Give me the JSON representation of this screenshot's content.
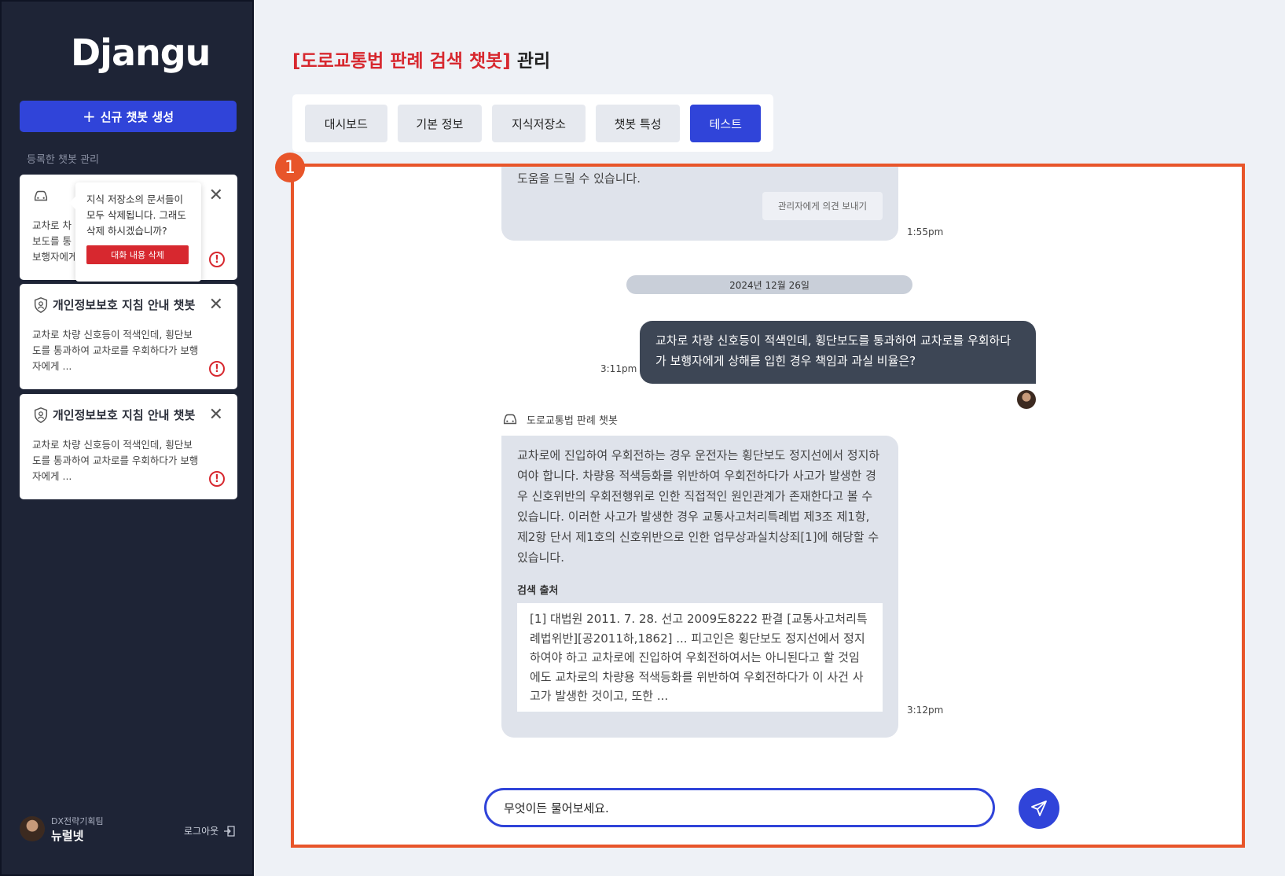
{
  "sidebar": {
    "logo": "Djangu",
    "new_button": {
      "icon": "plus-icon",
      "label": "신규 챗봇 생성"
    },
    "section_label": "등록한 챗봇 관리",
    "cards": [
      {
        "icon": "car-icon",
        "title": "",
        "body": "교차로 차\n보도를 통\n보행자에게"
      },
      {
        "icon": "shield-person-icon",
        "title": "개인정보보호 지침 안내 챗봇",
        "body": "교차로 차량 신호등이 적색인데, 횡단보도를 통과하여 교차로를 우회하다가 보행자에게 ..."
      },
      {
        "icon": "shield-person-icon",
        "title": "개인정보보호 지침 안내 챗봇",
        "body": "교차로 차량 신호등이 적색인데, 횡단보도를 통과하여 교차로를 우회하다가 보행자에게 ..."
      }
    ],
    "popover": {
      "text": "지식 저장소의 문서들이 모두 삭제됩니다. 그래도 삭제 하시겠습니까?",
      "button": "대화 내용 삭제"
    },
    "user": {
      "team": "DX전략기획팀",
      "name": "뉴럴넷"
    },
    "logout": "로그아웃"
  },
  "header": {
    "title_highlight": "[도로교통법 판례 검색 챗봇]",
    "title_rest": " 관리"
  },
  "tabs": [
    "대시보드",
    "기본 정보",
    "지식저장소",
    "챗봇 특성",
    "테스트"
  ],
  "active_tab": "테스트",
  "step_marker": "1",
  "chat": {
    "prev_bot_tail": "도움을 드릴 수 있습니다.",
    "feedback_button": "관리자에게 의견 보내기",
    "prev_time": "1:55pm",
    "date_divider": "2024년 12월 26일",
    "user_message": "교차로 차량 신호등이 적색인데, 횡단보도를 통과하여 교차로를 우회하다가 보행자에게 상해를 입힌 경우 책임과 과실 비율은?",
    "user_time": "3:11pm",
    "bot_name": "도로교통법 판례 챗봇",
    "bot_answer": "교차로에 진입하여 우회전하는 경우 운전자는 횡단보도 정지선에서 정지하여야 합니다. 차량용 적색등화를 위반하여 우회전하다가 사고가 발생한 경우 신호위반의 우회전행위로 인한 직접적인 원인관계가 존재한다고 볼 수 있습니다. 이러한 사고가 발생한 경우 교통사고처리특례법 제3조 제1항, 제2항 단서 제1호의 신호위반으로 인한 업무상과실치상죄[1]에 해당할 수 있습니다.",
    "source_title": "검색 출처",
    "source_text": "[1] 대법원 2011. 7. 28. 선고 2009도8222 판결 [교통사고처리특례법위반][공2011하,1862] ... 피고인은 횡단보도 정지선에서 정지하여야 하고 교차로에 진입하여 우회전하여서는 아니된다고 할 것임에도 교차로의 차량용 적색등화를 위반하여 우회전하다가 이 사건 사고가 발생한 것이고, 또한 ...",
    "bot_time": "3:12pm",
    "input_placeholder": "무엇이든 물어보세요.",
    "send_icon": "send-icon"
  },
  "colors": {
    "accent": "#3044d9",
    "highlight_red": "#d7282f",
    "annotation_orange": "#e8552a",
    "sidebar_bg": "#1e2436"
  }
}
